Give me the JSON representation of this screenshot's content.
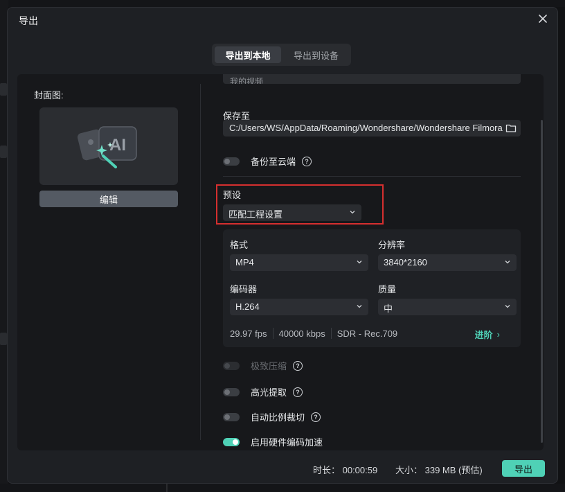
{
  "dialog": {
    "title": "导出",
    "close_icon": "close-icon"
  },
  "tabs": [
    {
      "label": "导出到本地",
      "active": true
    },
    {
      "label": "导出到设备",
      "active": false
    }
  ],
  "cover": {
    "label": "封面图:",
    "edit_label": "编辑",
    "icon": "ai-image-magic-icon"
  },
  "name_field": {
    "value": "我的视频"
  },
  "save_to": {
    "label": "保存至",
    "path": "C:/Users/WS/AppData/Roaming/Wondershare/Wondershare Filmora",
    "folder_icon": "folder-icon"
  },
  "backup": {
    "label": "备份至云端",
    "on": false
  },
  "preset": {
    "label": "预设",
    "value": "匹配工程设置"
  },
  "settings": {
    "format_label": "格式",
    "format_value": "MP4",
    "resolution_label": "分辨率",
    "resolution_value": "3840*2160",
    "encoder_label": "编码器",
    "encoder_value": "H.264",
    "quality_label": "质量",
    "quality_value": "中",
    "fps": "29.97 fps",
    "bitrate": "40000 kbps",
    "color": "SDR - Rec.709",
    "advanced_label": "进阶",
    "advanced_arrow": "›"
  },
  "toggles": [
    {
      "label": "极致压缩",
      "on": false,
      "disabled": true
    },
    {
      "label": "高光提取",
      "on": false,
      "disabled": false
    },
    {
      "label": "自动比例裁切",
      "on": false,
      "disabled": false
    },
    {
      "label": "启用硬件编码加速",
      "on": true,
      "disabled": false
    }
  ],
  "footer": {
    "duration": "时长： 00:00:59",
    "size": "大小： 339 MB (预估)",
    "export_label": "导出"
  },
  "colors": {
    "accent": "#4fd1b6",
    "highlight_border": "#d62f2f",
    "dialog_bg": "#1e2024"
  }
}
